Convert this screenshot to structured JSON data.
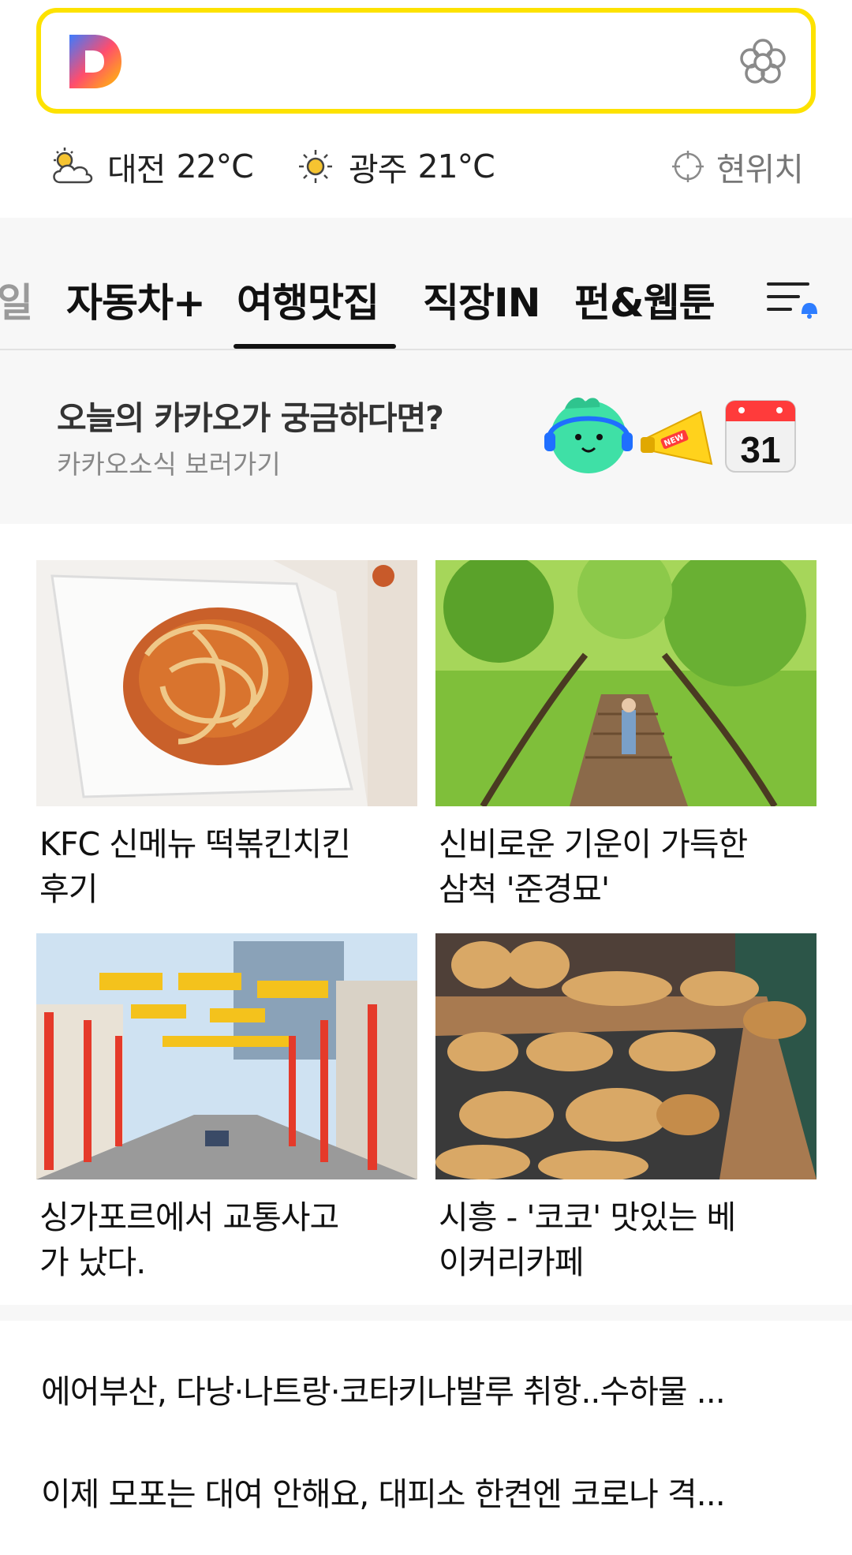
{
  "search": {
    "placeholder": "",
    "logo": "D",
    "logo_colors": [
      "#3b7bff",
      "#ff4d6d",
      "#ffc400"
    ],
    "accent": "#fde200"
  },
  "weather": [
    {
      "icon": "partly-cloudy-icon",
      "city": "대전",
      "temp": "22°C"
    },
    {
      "icon": "sun-icon",
      "city": "광주",
      "temp": "21°C"
    }
  ],
  "location": {
    "icon": "crosshair-icon",
    "label": "현위치"
  },
  "tabs": {
    "partial": "일",
    "items": [
      "자동차+",
      "여행맛집",
      "직장IN",
      "펀&웹툰"
    ],
    "active": "여행맛집",
    "menu_icon": "menu-bell-icon"
  },
  "promo": {
    "title": "오늘의 카카오가 궁금하다면?",
    "subtitle": "카카오소식 보러가기",
    "badge_new": "NEW",
    "calendar_day": "31"
  },
  "cards": [
    {
      "caption_line1": "KFC 신메뉴 떡볶킨치킨",
      "caption_line2": "후기",
      "image": "fried-chicken-photo"
    },
    {
      "caption_line1": "신비로운 기운이 가득한",
      "caption_line2": "삼척 '준경묘'",
      "image": "forest-boardwalk-photo"
    },
    {
      "caption_line1": "싱가포르에서 교통사고",
      "caption_line2": "가 났다.",
      "image": "chinatown-street-photo"
    },
    {
      "caption_line1": "시흥 - '코코' 맛있는 베",
      "caption_line2": "이커리카페",
      "image": "bakery-bread-photo"
    }
  ],
  "headlines": [
    "에어부산, 다낭·나트랑·코타키나발루 취항..수하물 ...",
    "이제 모포는 대여 안해요, 대피소 한켠엔 코로나 격..."
  ]
}
